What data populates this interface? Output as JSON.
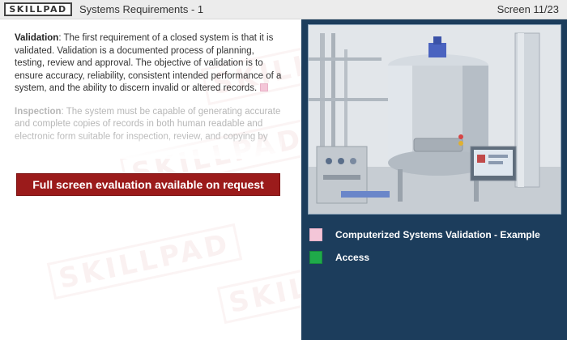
{
  "header": {
    "logo_text": "SKILLPAD",
    "title": "Systems Requirements - 1",
    "screen_counter": "Screen 11/23"
  },
  "content": {
    "validation_heading": "Validation",
    "validation_text": ": The first requirement of a closed system is that it is validated. Validation is a documented process of planning, testing, review and approval. The objective of validation is to ensure accuracy, reliability, consistent intended performance of a system, and the ability to discern invalid or altered records.",
    "inspection_heading": "Inspection",
    "inspection_text": ": The system must be capable of generating accurate and complete copies of records in both human readable and electronic form suitable for inspection, review, and copying by the FDA."
  },
  "eval_button_label": "Full screen evaluation available on request",
  "watermark_text": "SKILLPAD",
  "links": [
    {
      "label": "Computerized Systems Validation - Example",
      "color": "#f4c6d8"
    },
    {
      "label": "Access",
      "color": "#1faa4a"
    }
  ],
  "colors": {
    "panel": "#1c3d5c",
    "button": "#9b1b1b"
  }
}
